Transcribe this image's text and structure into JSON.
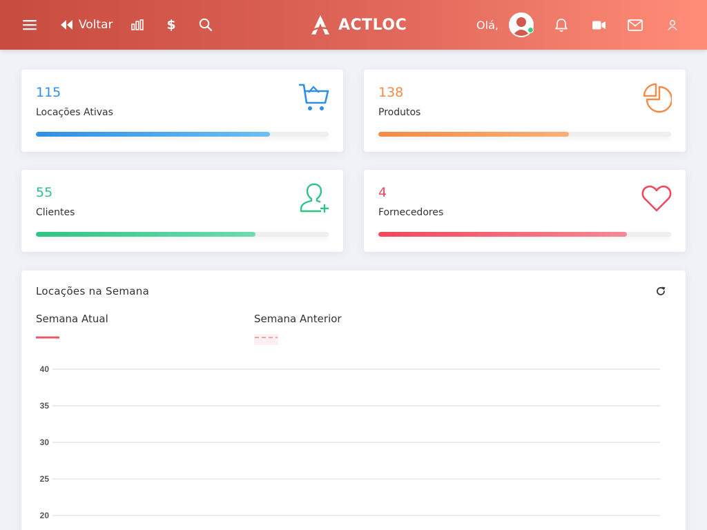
{
  "header": {
    "back_label": "Voltar",
    "dollar_symbol": "$",
    "brand_name": "ACTLOC",
    "greeting": "Olá,",
    "icons": [
      "menu-icon",
      "double-chevron-left-icon",
      "bar-chart-icon",
      "dollar-icon",
      "search-icon",
      "brand-logo",
      "avatar",
      "bell-icon",
      "video-camera-icon",
      "mail-icon",
      "user-icon"
    ],
    "online_status_color": "#2fd17e"
  },
  "stats": [
    {
      "value": "115",
      "label": "Locações Ativas",
      "icon": "shopping-cart-icon",
      "color": "#2f8fe6",
      "progress": 0.8
    },
    {
      "value": "138",
      "label": "Produtos",
      "icon": "pie-chart-icon",
      "color": "#f48a45",
      "progress": 0.65
    },
    {
      "value": "55",
      "label": "Clientes",
      "icon": "user-add-icon",
      "color": "#2fc486",
      "progress": 0.75
    },
    {
      "value": "4",
      "label": "Fornecedores",
      "icon": "heart-icon",
      "color": "#f2475c",
      "progress": 0.85
    }
  ],
  "weekly_chart": {
    "title": "Locações na Semana",
    "refresh_icon": "refresh-icon",
    "legend": [
      {
        "label": "Semana Atual",
        "color": "#e65a68",
        "style": "solid"
      },
      {
        "label": "Semana Anterior",
        "color": "#f4a3ab",
        "style": "dashed"
      }
    ]
  },
  "chart_data": {
    "type": "line",
    "title": "Locações na Semana",
    "series": [
      {
        "name": "Semana Atual",
        "values": []
      },
      {
        "name": "Semana Anterior",
        "values": []
      }
    ],
    "y_ticks": [
      40,
      35,
      30,
      25,
      20
    ],
    "ylim": [
      20,
      40
    ],
    "grid": true,
    "legend_position": "top-left"
  }
}
